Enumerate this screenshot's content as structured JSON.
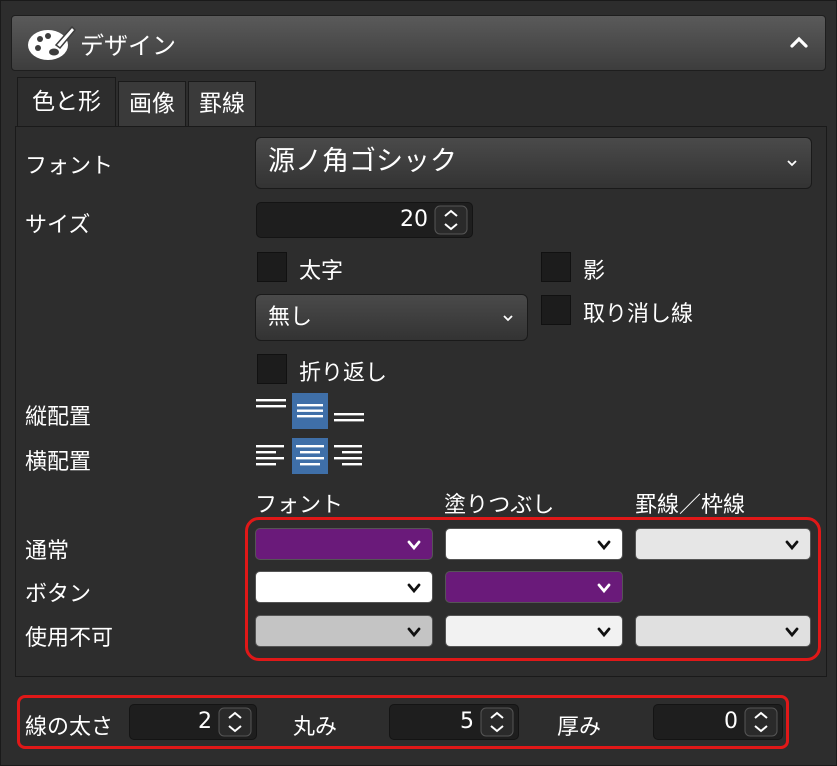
{
  "header": {
    "title": "デザイン",
    "logo_icon": "palette-icon",
    "collapse_icon": "chevron-up-icon"
  },
  "tabs": [
    {
      "label": "色と形",
      "active": true
    },
    {
      "label": "画像",
      "active": false
    },
    {
      "label": "罫線",
      "active": false
    }
  ],
  "font": {
    "label": "フォント",
    "value": "源ノ角ゴシック"
  },
  "size": {
    "label": "サイズ",
    "value": "20"
  },
  "checkboxes": {
    "bold": "太字",
    "shadow": "影",
    "strike": "取り消し線",
    "wrap": "折り返し"
  },
  "underline": {
    "value": "無し"
  },
  "align": {
    "vertical_label": "縦配置",
    "horizontal_label": "横配置"
  },
  "color_columns": {
    "font": "フォント",
    "fill": "塗りつぶし",
    "border": "罫線／枠線"
  },
  "color_rows": [
    {
      "label": "通常",
      "font": "#6a1a7a",
      "fill": "#ffffff",
      "border": "#e6e6e6"
    },
    {
      "label": "ボタン",
      "font": "#ffffff",
      "fill": "#6a1a7a",
      "border": ""
    },
    {
      "label": "使用不可",
      "font": "#c4c4c4",
      "fill": "#f2f2f2",
      "border": "#e0e0e0"
    }
  ],
  "bottom": {
    "line_width_label": "線の太さ",
    "line_width": "2",
    "round_label": "丸み",
    "round": "5",
    "depth_label": "厚み",
    "depth": "0"
  },
  "colors": {
    "highlight_border": "#e01818",
    "active_align": "#3f6fa8",
    "accent_purple": "#6a1a7a"
  }
}
